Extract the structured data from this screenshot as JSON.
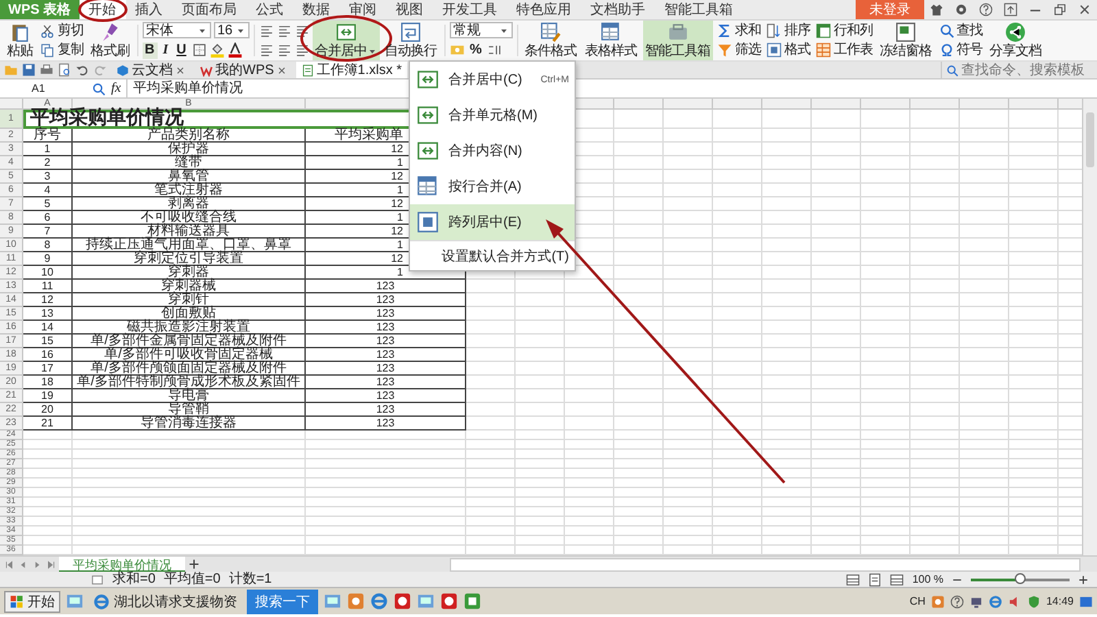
{
  "app": {
    "name": "WPS 表格",
    "login": "未登录"
  },
  "menu_tabs": [
    {
      "label": "开始",
      "selected": true,
      "circled": true
    },
    {
      "label": "插入",
      "selected": false,
      "circled": false
    },
    {
      "label": "页面布局",
      "selected": false,
      "circled": false
    },
    {
      "label": "公式",
      "selected": false,
      "circled": false
    },
    {
      "label": "数据",
      "selected": false,
      "circled": false
    },
    {
      "label": "审阅",
      "selected": false,
      "circled": false
    },
    {
      "label": "视图",
      "selected": false,
      "circled": false
    },
    {
      "label": "开发工具",
      "selected": false,
      "circled": false
    },
    {
      "label": "特色应用",
      "selected": false,
      "circled": false
    },
    {
      "label": "文档助手",
      "selected": false,
      "circled": false
    },
    {
      "label": "智能工具箱",
      "selected": false,
      "circled": false
    }
  ],
  "clipboard": {
    "paste": "粘贴",
    "cut": "剪切",
    "copy": "复制",
    "format_painter": "格式刷"
  },
  "font": {
    "name": "宋体",
    "size": "16",
    "bold": "B",
    "italic": "I",
    "underline": "U"
  },
  "merge_button": {
    "label": "合并居中",
    "circled": true,
    "expanded": true
  },
  "wrap_button": {
    "label": "自动换行"
  },
  "number_format": {
    "value": "常规",
    "percent": "%"
  },
  "tools": [
    {
      "label": "条件格式",
      "kind": "large",
      "on": false
    },
    {
      "label": "表格样式",
      "kind": "large",
      "on": false
    },
    {
      "label": "智能工具箱",
      "kind": "large",
      "on": true
    },
    {
      "label": "求和",
      "kind": "small",
      "on": false
    },
    {
      "label": "筛选",
      "kind": "small",
      "on": false
    },
    {
      "label": "排序",
      "kind": "small",
      "on": false
    },
    {
      "label": "格式",
      "kind": "small",
      "on": false
    },
    {
      "label": "行和列",
      "kind": "small",
      "on": false
    },
    {
      "label": "工作表",
      "kind": "small",
      "on": false
    },
    {
      "label": "冻结窗格",
      "kind": "large",
      "on": false
    },
    {
      "label": "查找",
      "kind": "small",
      "on": false
    },
    {
      "label": "符号",
      "kind": "small",
      "on": false
    },
    {
      "label": "分享文档",
      "kind": "large",
      "on": false
    }
  ],
  "doc_tabs": [
    {
      "label": "云文档",
      "selected": false
    },
    {
      "label": "我的WPS",
      "selected": false
    },
    {
      "label": "工作簿1.xlsx *",
      "selected": true
    }
  ],
  "search": {
    "placeholder": "查找命令、搜索模板"
  },
  "formula_bar": {
    "cell": "A1",
    "fx": "fx",
    "value": "平均采购单价情况"
  },
  "merge_menu": {
    "items": [
      {
        "label": "合并居中(C)",
        "shortcut": "Ctrl+M",
        "selected": false
      },
      {
        "label": "合并单元格(M)",
        "selected": false
      },
      {
        "label": "合并内容(N)",
        "selected": false
      },
      {
        "label": "按行合并(A)",
        "selected": false
      },
      {
        "label": "跨列居中(E)",
        "selected": true
      }
    ],
    "footer": "设置默认合并方式(T)"
  },
  "sheet": {
    "columns": [
      "A",
      "B"
    ],
    "row_numbers": [
      "1",
      "2",
      "3",
      "4",
      "5",
      "6",
      "7",
      "8",
      "9",
      "10",
      "11",
      "12",
      "13",
      "14",
      "15",
      "16",
      "17",
      "18",
      "19",
      "20",
      "21",
      "22",
      "23",
      "24",
      "25",
      "26",
      "27",
      "28",
      "29",
      "30",
      "31",
      "32",
      "33",
      "34",
      "35",
      "36"
    ],
    "title": "平均采购单价情况",
    "header": [
      "序号",
      "产品类别名称",
      "平均采购单"
    ],
    "rows": [
      [
        "1",
        "保护器",
        "12"
      ],
      [
        "2",
        "缝带",
        "1"
      ],
      [
        "3",
        "鼻氧管",
        "12"
      ],
      [
        "4",
        "笔式注射器",
        "1"
      ],
      [
        "5",
        "剥离器",
        "12"
      ],
      [
        "6",
        "不可吸收缝合线",
        "1"
      ],
      [
        "7",
        "材料输送器具",
        "12"
      ],
      [
        "8",
        "持续正压通气用面罩、口罩、鼻罩",
        "1"
      ],
      [
        "9",
        "穿刺定位引导装置",
        "12"
      ],
      [
        "10",
        "穿刺器",
        "1"
      ],
      [
        "11",
        "穿刺器械",
        "123"
      ],
      [
        "12",
        "穿刺针",
        "123"
      ],
      [
        "13",
        "创面敷贴",
        "123"
      ],
      [
        "14",
        "磁共振造影注射装置",
        "123"
      ],
      [
        "15",
        "单/多部件金属骨固定器械及附件",
        "123"
      ],
      [
        "16",
        "单/多部件可吸收骨固定器械",
        "123"
      ],
      [
        "17",
        "单/多部件颅颌面固定器械及附件",
        "123"
      ],
      [
        "18",
        "单/多部件特制颅骨成形术板及紧固件",
        "123"
      ],
      [
        "19",
        "导电膏",
        "123"
      ],
      [
        "20",
        "导管鞘",
        "123"
      ],
      [
        "21",
        "导管消毒连接器",
        "123"
      ]
    ]
  },
  "sheet_tabs": [
    {
      "label": "平均采购单价情况",
      "selected": true
    }
  ],
  "status_bar": {
    "stats": [
      "求和=0",
      "平均值=0",
      "计数=1"
    ],
    "zoom": "100 %",
    "zoom_slider": {
      "level": 0.5
    }
  },
  "taskbar": {
    "start": "开始",
    "window": "湖北以请求支援物资",
    "search_button": "搜索一下",
    "language": "CH",
    "time": "14:49"
  },
  "annotation": {
    "arrow": true
  }
}
